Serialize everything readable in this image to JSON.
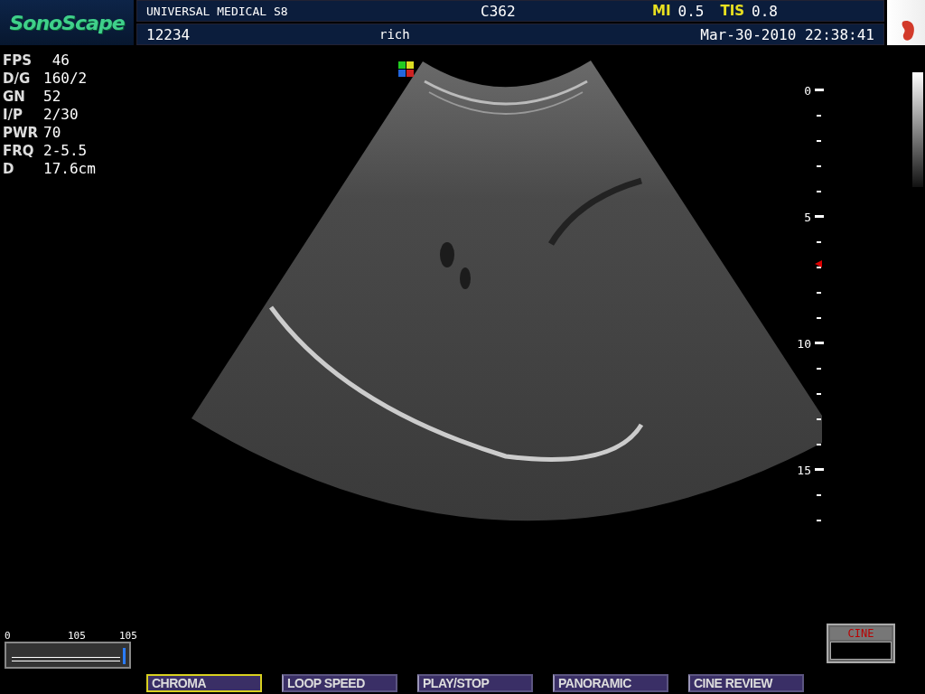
{
  "header": {
    "logo": "SonoScape",
    "system": "UNIVERSAL MEDICAL S8",
    "probe": "C362",
    "mi_label": "MI",
    "mi_value": "0.5",
    "tis_label": "TIS",
    "tis_value": "0.8",
    "patient_id": "12234",
    "operator": "rich",
    "datetime": "Mar-30-2010 22:38:41"
  },
  "params": [
    {
      "label": "FPS",
      "value": " 46"
    },
    {
      "label": "D/G",
      "value": "160/2"
    },
    {
      "label": "GN",
      "value": "52"
    },
    {
      "label": "I/P",
      "value": "2/30"
    },
    {
      "label": "PWR",
      "value": "70"
    },
    {
      "label": "FRQ",
      "value": "2-5.5"
    },
    {
      "label": "D",
      "value": "17.6cm"
    }
  ],
  "depth_scale": {
    "labels": [
      "0",
      "5",
      "10",
      "15"
    ]
  },
  "slider": {
    "labels": [
      "0",
      "105",
      "105"
    ],
    "level": 1
  },
  "cine": {
    "label": "CINE"
  },
  "buttons": [
    {
      "label": "CHROMA",
      "selected": true
    },
    {
      "label": "LOOP SPEED",
      "selected": false
    },
    {
      "label": "PLAY/STOP",
      "selected": false
    },
    {
      "label": "PANORAMIC",
      "selected": false
    },
    {
      "label": "CINE REVIEW",
      "selected": false
    }
  ]
}
